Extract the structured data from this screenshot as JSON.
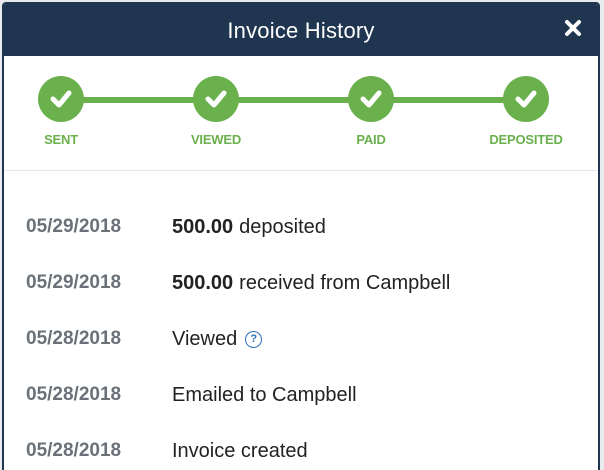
{
  "dialog": {
    "title": "Invoice History",
    "close_icon": "close-icon",
    "colors": {
      "header": "#1f3550",
      "progress": "#6ab04c",
      "date": "#6b7178",
      "help": "#2a6fbb"
    }
  },
  "steps": [
    {
      "label": "SENT",
      "icon": "check-icon",
      "done": true
    },
    {
      "label": "VIEWED",
      "icon": "check-icon",
      "done": true
    },
    {
      "label": "PAID",
      "icon": "check-icon",
      "done": true
    },
    {
      "label": "DEPOSITED",
      "icon": "check-icon",
      "done": true
    }
  ],
  "history": [
    {
      "date": "05/29/2018",
      "amount": "500.00",
      "text": "deposited"
    },
    {
      "date": "05/29/2018",
      "amount": "500.00",
      "text": "received from Campbell"
    },
    {
      "date": "05/28/2018",
      "amount": "",
      "text": "Viewed",
      "help_icon": "?"
    },
    {
      "date": "05/28/2018",
      "amount": "",
      "text": "Emailed to Campbell"
    },
    {
      "date": "05/28/2018",
      "amount": "",
      "text": "Invoice created"
    }
  ]
}
